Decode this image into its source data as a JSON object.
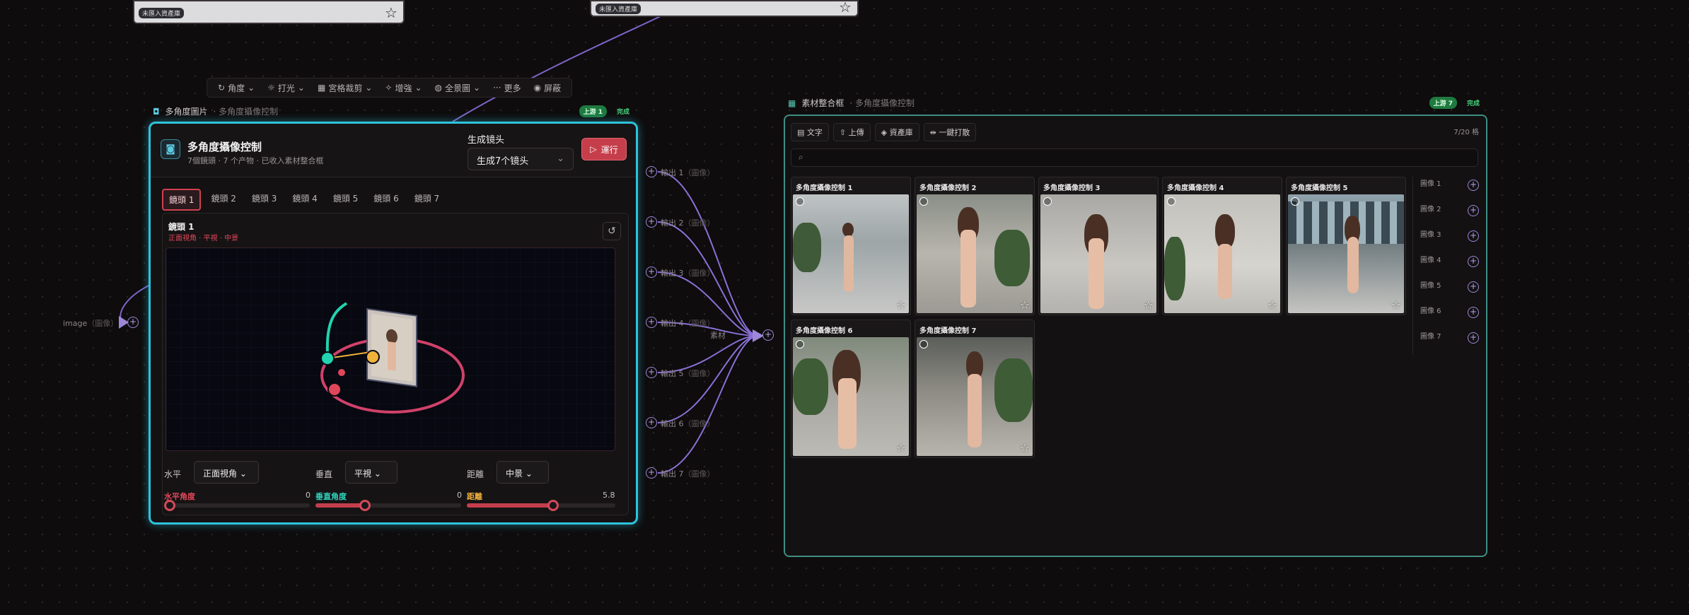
{
  "top_cards": [
    {
      "badge": "未匯入資產庫"
    },
    {
      "badge": "未匯入資產庫"
    }
  ],
  "toolbar": {
    "items": [
      {
        "icon": "rotate-icon",
        "label": "角度"
      },
      {
        "icon": "sun-icon",
        "label": "打光"
      },
      {
        "icon": "grid-icon",
        "label": "宮格裁剪"
      },
      {
        "icon": "wand-icon",
        "label": "增強"
      },
      {
        "icon": "globe-icon",
        "label": "全景圖"
      },
      {
        "icon": "more-icon",
        "label": "更多"
      },
      {
        "icon": "eye-icon",
        "label": "屏蔽"
      }
    ]
  },
  "left_node": {
    "header_title": "多角度圖片",
    "header_sub": "· 多角度攝像控制",
    "pill_upstream": "上游 1",
    "pill_status": "完成",
    "title": "多角度攝像控制",
    "desc": "7個鏡頭 · 7 个产物 · 已收入素材整合框",
    "gen_label": "生成镜头",
    "gen_value": "生成7个镜头",
    "run_label": "運行",
    "tabs": [
      "鏡頭 1",
      "鏡頭 2",
      "鏡頭 3",
      "鏡頭 4",
      "鏡頭 5",
      "鏡頭 6",
      "鏡頭 7"
    ],
    "shot_title": "鏡頭 1",
    "shot_sub": "正面視角 · 平視 · 中景",
    "controls": {
      "horizontal_label": "水平",
      "horizontal_value": "正面視角",
      "vertical_label": "垂直",
      "vertical_value": "平視",
      "distance_label": "距離",
      "distance_value": "中景"
    },
    "sliders": [
      {
        "label": "水平角度",
        "value": "0",
        "fraction": 0.0,
        "color": "#e0475a"
      },
      {
        "label": "垂直角度",
        "value": "0",
        "fraction": 0.34,
        "color": "#2fd6c0"
      },
      {
        "label": "距離",
        "value": "5.8",
        "fraction": 0.58,
        "color": "#f0b23a"
      }
    ],
    "input_label": "image",
    "input_type": "（圖像）"
  },
  "outputs": [
    {
      "label": "輸出 1",
      "type": "（圖像）"
    },
    {
      "label": "輸出 2",
      "type": "（圖像）"
    },
    {
      "label": "輸出 3",
      "type": "（圖像）"
    },
    {
      "label": "輸出 4",
      "type": "（圖像）"
    },
    {
      "label": "輸出 5",
      "type": "（圖像）"
    },
    {
      "label": "輸出 6",
      "type": "（圖像）"
    },
    {
      "label": "輸出 7",
      "type": "（圖像）"
    }
  ],
  "material_port_label": "素材",
  "right_node": {
    "header_title": "素材整合框",
    "header_sub": "· 多角度攝像控制",
    "pill_upstream": "上游 7",
    "pill_status": "完成",
    "tools": [
      {
        "icon": "file-icon",
        "label": "文字"
      },
      {
        "icon": "upload-icon",
        "label": "上傳"
      },
      {
        "icon": "layers-icon",
        "label": "資產庫"
      },
      {
        "icon": "split-icon",
        "label": "一鍵打散"
      }
    ],
    "count": "7/20 格",
    "cards": [
      {
        "title": "多角度攝像控制 1"
      },
      {
        "title": "多角度攝像控制 2"
      },
      {
        "title": "多角度攝像控制 3"
      },
      {
        "title": "多角度攝像控制 4"
      },
      {
        "title": "多角度攝像控制 5"
      },
      {
        "title": "多角度攝像控制 6"
      },
      {
        "title": "多角度攝像控制 7"
      }
    ],
    "side_items": [
      "圖像 1",
      "圖像 2",
      "圖像 3",
      "圖像 4",
      "圖像 5",
      "圖像 6",
      "圖像 7"
    ]
  },
  "colors": {
    "node_border": "#2fc3dc",
    "right_border": "#3f8e85",
    "accent_red": "#c63e4b",
    "port": "#9e87d8"
  }
}
